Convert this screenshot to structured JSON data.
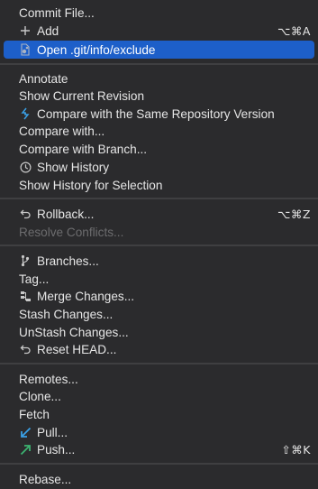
{
  "menu": {
    "commit_file": "Commit File...",
    "add": "Add",
    "add_shortcut": "⌥⌘A",
    "open_exclude": "Open .git/info/exclude",
    "annotate": "Annotate",
    "show_current_revision": "Show Current Revision",
    "compare_same_repo": "Compare with the Same Repository Version",
    "compare_with": "Compare with...",
    "compare_branch": "Compare with Branch...",
    "show_history": "Show History",
    "show_history_selection": "Show History for Selection",
    "rollback": "Rollback...",
    "rollback_shortcut": "⌥⌘Z",
    "resolve_conflicts": "Resolve Conflicts...",
    "branches": "Branches...",
    "tag": "Tag...",
    "merge_changes": "Merge Changes...",
    "stash_changes": "Stash Changes...",
    "unstash_changes": "UnStash Changes...",
    "reset_head": "Reset HEAD...",
    "remotes": "Remotes...",
    "clone": "Clone...",
    "fetch": "Fetch",
    "pull": "Pull...",
    "push": "Push...",
    "push_shortcut": "⇧⌘K",
    "rebase": "Rebase..."
  },
  "colors": {
    "background": "#2b2b2d",
    "highlight": "#1d5fc9",
    "text": "#e6e6e6",
    "disabled_text": "#6c6c6e",
    "pull_arrow": "#3aa0e6",
    "push_arrow": "#3cb371"
  },
  "icons": {
    "add": "plus-icon",
    "open_exclude": "file-exclude-icon",
    "compare_same_repo": "compare-arrows-icon",
    "show_history": "clock-icon",
    "rollback": "undo-icon",
    "branches": "branch-icon",
    "merge_changes": "merge-icon",
    "reset_head": "undo-icon",
    "pull": "pull-arrow-icon",
    "push": "push-arrow-icon"
  }
}
